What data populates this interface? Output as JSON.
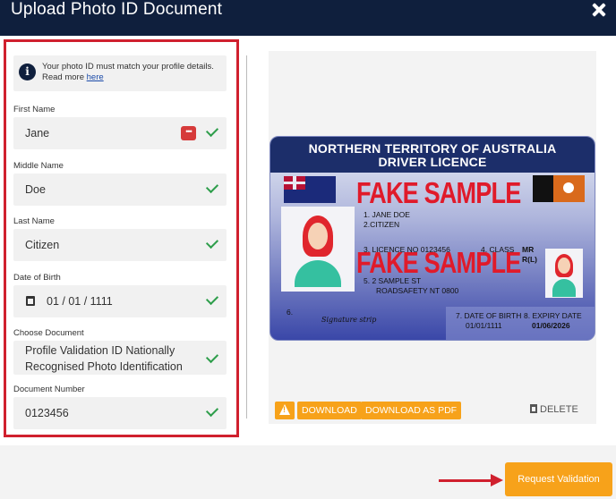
{
  "header": {
    "title": "Upload Photo ID Document",
    "close_icon": "close-icon"
  },
  "form": {
    "info": {
      "text": "Your photo ID must match your profile details. Read more ",
      "link": "here"
    },
    "first_name": {
      "label": "First Name",
      "value": "Jane"
    },
    "middle_name": {
      "label": "Middle Name",
      "value": "Doe"
    },
    "last_name": {
      "label": "Last Name",
      "value": "Citizen"
    },
    "dob": {
      "label": "Date of Birth",
      "value": "01 / 01 / 1111"
    },
    "document": {
      "label": "Choose Document",
      "value": "Profile Validation ID Nationally Recognised Photo Identification"
    },
    "document_number": {
      "label": "Document Number",
      "value": "0123456"
    }
  },
  "card": {
    "title_line1": "NORTHERN TERRITORY OF AUSTRALIA",
    "title_line2": "DRIVER LICENCE",
    "stamp": "FAKE SAMPLE",
    "name_line1": "1. JANE DOE",
    "name_line2": "2.CITIZEN",
    "licence_no": "3.  LICENCE NO 0123456",
    "class_label": "4.  CLASS",
    "class_value": "MR",
    "class_value2": "R(L)",
    "address_line1": "5.  2 SAMPLE ST",
    "address_line2": "ROADSAFETY NT 0800",
    "field6": "6.",
    "signature": "Signature strip",
    "dob_label": "7. DATE OF BIRTH",
    "dob_value": "01/01/1111",
    "expiry_label": "8. EXPIRY DATE",
    "expiry_value": "01/06/2026"
  },
  "actions": {
    "download": "DOWNLOAD",
    "download_pdf": "DOWNLOAD AS PDF",
    "delete": "DELETE"
  },
  "footer": {
    "request_button": "Request Validation"
  },
  "colors": {
    "header_bg": "#0f1f3d",
    "accent": "#f7a21a",
    "highlight": "#d0202e",
    "check": "#2e9e4b"
  }
}
